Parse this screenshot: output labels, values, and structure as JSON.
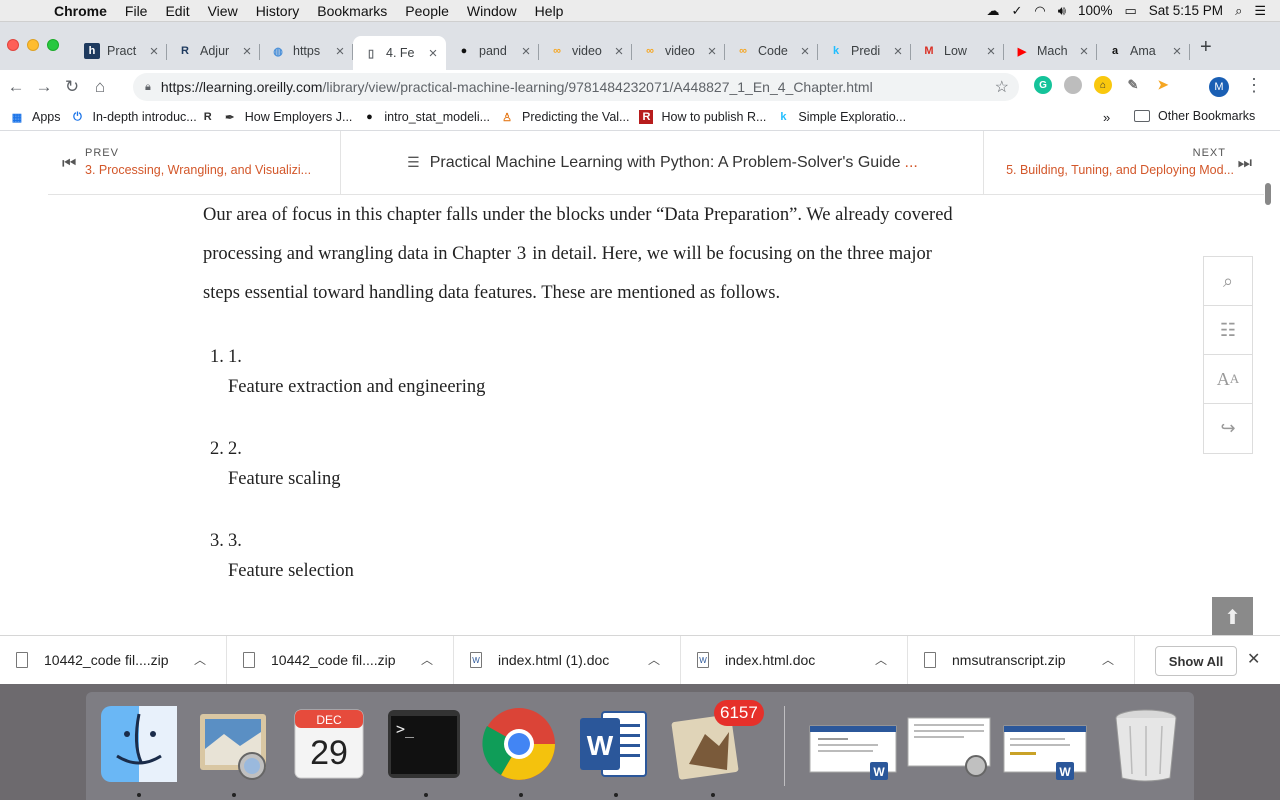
{
  "menubar": {
    "app": "Chrome",
    "items": [
      "File",
      "Edit",
      "View",
      "History",
      "Bookmarks",
      "People",
      "Window",
      "Help"
    ],
    "battery": "100%",
    "clock": "Sat 5:15 PM"
  },
  "tabs": [
    {
      "title": "Pract",
      "icon": "h",
      "icon_color": "#1e3a5f"
    },
    {
      "title": "Adjur",
      "icon": "R",
      "icon_color": "#1e3a5f"
    },
    {
      "title": "https",
      "icon": "globe",
      "icon_color": "#4a90d9"
    },
    {
      "title": "4. Fe",
      "icon": "doc",
      "icon_color": "#5f6368",
      "active": true
    },
    {
      "title": "pand",
      "icon": "github",
      "icon_color": "#111111"
    },
    {
      "title": "video",
      "icon": "co",
      "icon_color": "#f5a623"
    },
    {
      "title": "video",
      "icon": "co",
      "icon_color": "#f5a623"
    },
    {
      "title": "Code",
      "icon": "co",
      "icon_color": "#f5a623"
    },
    {
      "title": "Predi",
      "icon": "k",
      "icon_color": "#20beff"
    },
    {
      "title": "Low",
      "icon": "M",
      "icon_color": "#d93025"
    },
    {
      "title": "Mach",
      "icon": "yt",
      "icon_color": "#ff0000"
    },
    {
      "title": "Ama",
      "icon": "a",
      "icon_color": "#111111"
    }
  ],
  "toolbar": {
    "url_host": "https://learning.oreilly.com",
    "url_path": "/library/view/practical-machine-learning/9781484232071/A448827_1_En_4_Chapter.html",
    "profile_initial": "M"
  },
  "bookmarks": [
    {
      "label": "Apps",
      "icon": "grid"
    },
    {
      "label": "In-depth introduc...",
      "icon": "power"
    },
    {
      "label": "",
      "icon": "R"
    },
    {
      "label": "How Employers J...",
      "icon": "quill"
    },
    {
      "label": "intro_stat_modeli...",
      "icon": "github"
    },
    {
      "label": "Predicting the Val...",
      "icon": "person"
    },
    {
      "label": "How to publish R...",
      "icon": "R"
    },
    {
      "label": "Simple Exploratio...",
      "icon": "k"
    }
  ],
  "bookmarks_more": "»",
  "bookmarks_other": "Other Bookmarks",
  "page": {
    "prev_label": "PREV",
    "prev_link": "3. Processing, Wrangling, and Visualizi...",
    "toc_title": "Practical Machine Learning with Python: A Problem-Solver's Guide",
    "toc_ellipsis": "...",
    "next_label": "NEXT",
    "next_link": "5. Building, Tuning, and Deploying Mod...",
    "para_1": "Our area of focus in this chapter falls under the blocks under “Data Preparation”. We already covered",
    "para_2a": "processing and wrangling data in Chapter",
    "para_2_ch": "3",
    "para_2b": "in detail. Here, we will be focusing on the three major",
    "para_3": "steps essential toward handling data features. These are mentioned as follows.",
    "list": [
      {
        "num": "1.",
        "num2": "1.",
        "text": "Feature extraction and engineering"
      },
      {
        "num": "2.",
        "num2": "2.",
        "text": "Feature scaling"
      },
      {
        "num": "3.",
        "num2": "3.",
        "text": "Feature selection"
      }
    ]
  },
  "downloads": [
    {
      "name": "10442_code fil....zip",
      "type": "zip"
    },
    {
      "name": "10442_code fil....zip",
      "type": "zip"
    },
    {
      "name": "index.html (1).doc",
      "type": "doc"
    },
    {
      "name": "index.html.doc",
      "type": "doc"
    },
    {
      "name": "nmsutranscript.zip",
      "type": "zip"
    }
  ],
  "downloads_show_all": "Show All",
  "dock": {
    "calendar_month": "DEC",
    "calendar_day": "29",
    "mail_badge": "6157"
  }
}
